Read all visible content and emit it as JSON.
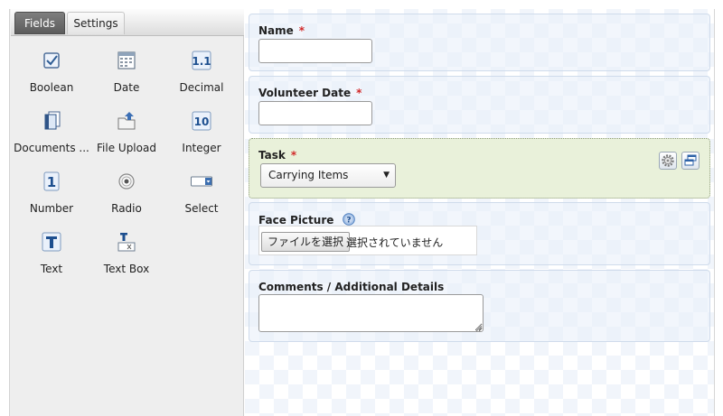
{
  "tabs": {
    "fields": "Fields",
    "settings": "Settings"
  },
  "field_types": [
    {
      "label": "Boolean",
      "icon": "checkbox-icon"
    },
    {
      "label": "Date",
      "icon": "calendar-icon"
    },
    {
      "label": "Decimal",
      "icon": "decimal-icon"
    },
    {
      "label": "Documents ...",
      "icon": "documents-icon"
    },
    {
      "label": "File Upload",
      "icon": "file-upload-icon"
    },
    {
      "label": "Integer",
      "icon": "integer-icon"
    },
    {
      "label": "Number",
      "icon": "number-icon"
    },
    {
      "label": "Radio",
      "icon": "radio-icon"
    },
    {
      "label": "Select",
      "icon": "select-icon"
    },
    {
      "label": "Text",
      "icon": "text-icon"
    },
    {
      "label": "Text Box",
      "icon": "text-box-icon"
    }
  ],
  "form": {
    "name": {
      "label": "Name",
      "required": "*",
      "value": ""
    },
    "volunteer_date": {
      "label": "Volunteer Date",
      "required": "*",
      "value": ""
    },
    "task": {
      "label": "Task",
      "required": "*",
      "selected": "Carrying Items"
    },
    "face_picture": {
      "label": "Face Picture",
      "button": "ファイルを選択",
      "status": "選択されていません"
    },
    "comments": {
      "label": "Comments / Additional Details",
      "value": ""
    }
  },
  "colors": {
    "required": "#d12a2a",
    "selected_row": "#e9f1da",
    "row_border": "#cfdbeb"
  }
}
